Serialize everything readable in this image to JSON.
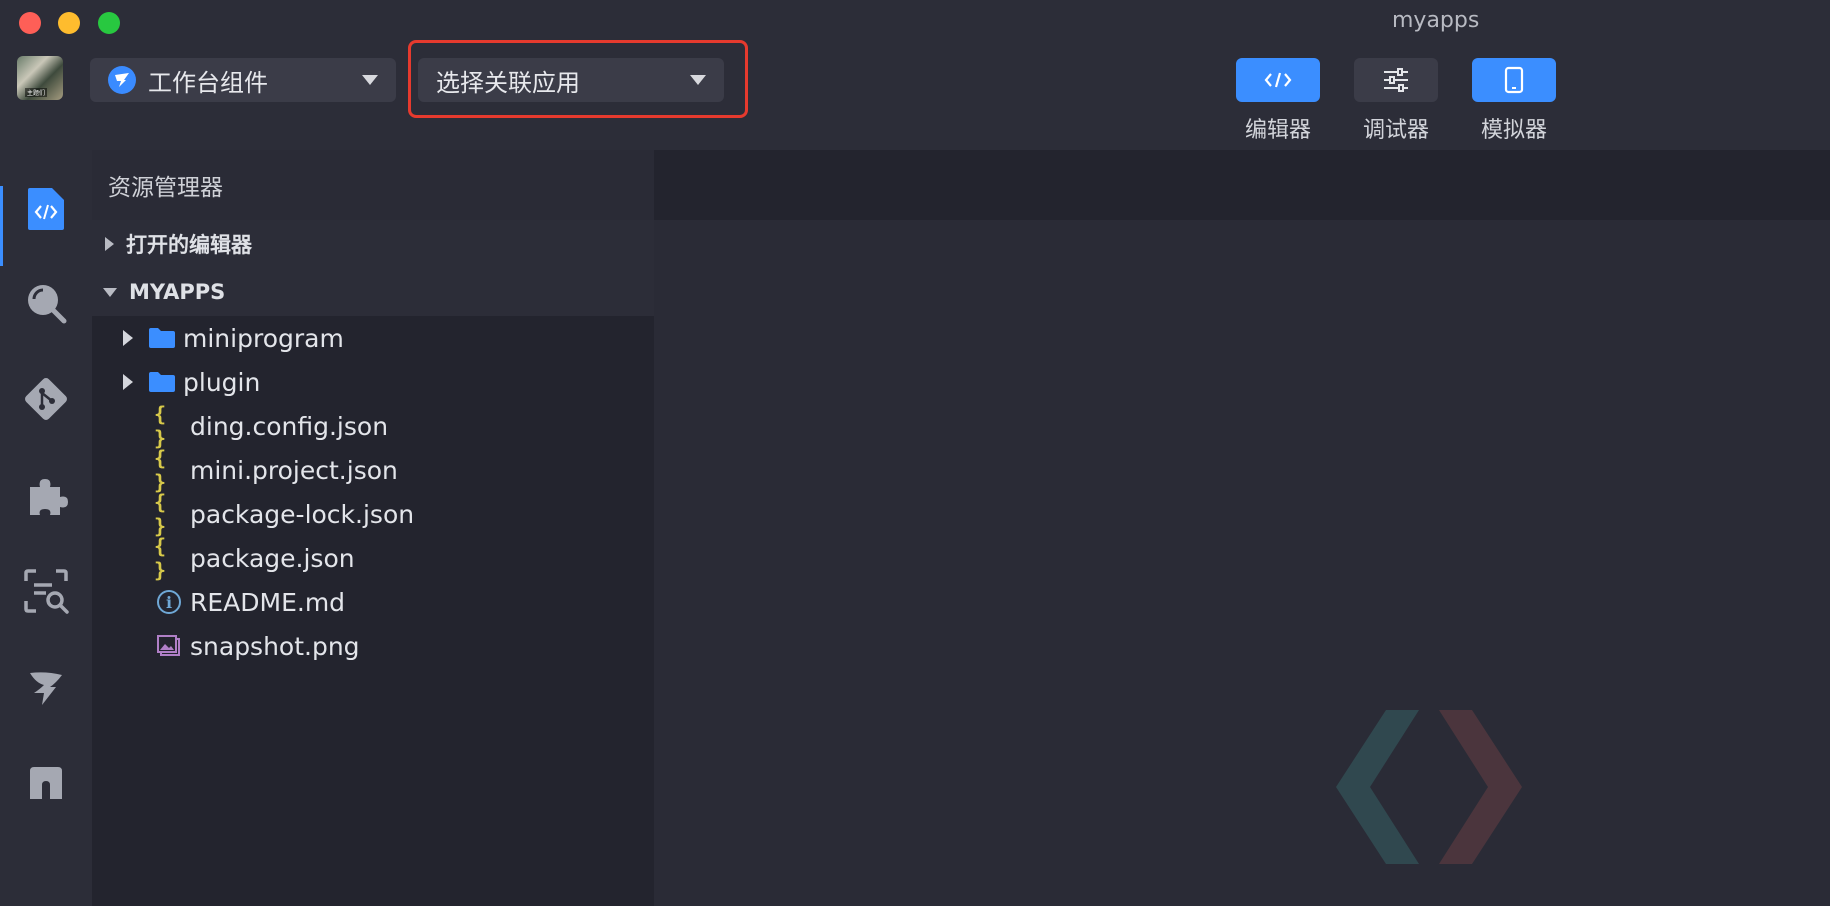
{
  "window": {
    "title": "myapps"
  },
  "toolbar": {
    "workbench_dropdown": {
      "label": "工作台组件"
    },
    "app_dropdown": {
      "label": "选择关联应用"
    },
    "modes": [
      {
        "label": "编辑器",
        "icon": "code-icon",
        "active": true
      },
      {
        "label": "调试器",
        "icon": "sliders-icon",
        "active": false
      },
      {
        "label": "模拟器",
        "icon": "phone-icon",
        "active": true
      }
    ],
    "avatar_tag": "主题们"
  },
  "activity_bar": [
    {
      "icon": "code-file-icon",
      "active": true
    },
    {
      "icon": "search-icon",
      "active": false
    },
    {
      "icon": "git-icon",
      "active": false
    },
    {
      "icon": "puzzle-icon",
      "active": false
    },
    {
      "icon": "scan-search-icon",
      "active": false
    },
    {
      "icon": "dingtalk-icon",
      "active": false
    },
    {
      "icon": "box-icon",
      "active": false
    }
  ],
  "explorer": {
    "title": "资源管理器",
    "open_editors": "打开的编辑器",
    "project": "MYAPPS",
    "items": [
      {
        "name": "miniprogram",
        "type": "folder"
      },
      {
        "name": "plugin",
        "type": "folder"
      },
      {
        "name": "ding.config.json",
        "type": "json"
      },
      {
        "name": "mini.project.json",
        "type": "json"
      },
      {
        "name": "package-lock.json",
        "type": "json"
      },
      {
        "name": "package.json",
        "type": "json"
      },
      {
        "name": "README.md",
        "type": "info"
      },
      {
        "name": "snapshot.png",
        "type": "image"
      }
    ]
  },
  "colors": {
    "accent": "#3b8eff",
    "highlight": "#e63a2e",
    "json": "#d7c94a",
    "folder": "#3b8eff"
  }
}
